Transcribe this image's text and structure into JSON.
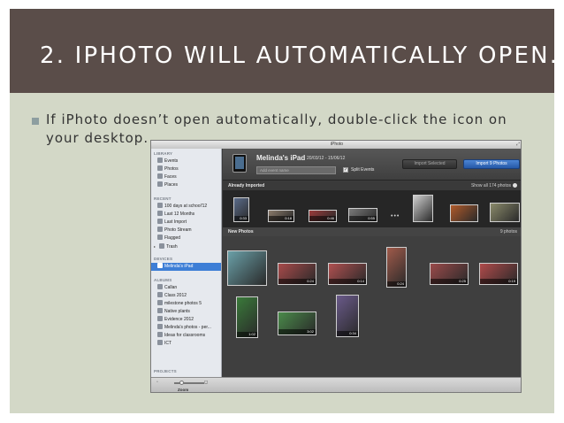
{
  "slide": {
    "title": "2.  IPHOTO WILL AUTOMATICALLY OPEN.",
    "bullet": "If iPhoto doesn’t open automatically, double-click the icon on your desktop."
  },
  "window": {
    "title": "iPhoto",
    "resize_glyph": "⤢"
  },
  "sidebar": {
    "library_heading": "LIBRARY",
    "library": [
      "Events",
      "Photos",
      "Faces",
      "Places"
    ],
    "recent_heading": "RECENT",
    "recent": [
      "100 days at school'12",
      "Last 12 Months",
      "Last Import",
      "Photo Stream",
      "Flagged",
      "Trash"
    ],
    "devices_heading": "DEVICES",
    "device": "Melinda's iPad",
    "albums_heading": "ALBUMS",
    "albums": [
      "Callan",
      "Class 2012",
      "milestone photos 5",
      "Native plants",
      "Evidence 2012",
      "Melinda's photos - per...",
      "Ideas for classrooms",
      "ICT"
    ],
    "projects_heading": "PROJECTS"
  },
  "device_header": {
    "name": "Melinda's iPad",
    "dates": "20/03/12 - 15/06/12",
    "event_placeholder": "Add event name",
    "split_events": "Split Events",
    "split_checked": "✓",
    "import_selected": "Import Selected",
    "import_photos": "Import 9 Photos"
  },
  "already_imported": {
    "heading": "Already Imported",
    "show_all": "Show all 174 photos",
    "more": "•••",
    "thumbs": [
      {
        "duration": "0:33",
        "color": "#5a6b8a"
      },
      {
        "duration": "0:18",
        "color": "#8a7a6a"
      },
      {
        "duration": "0:46",
        "color": "#9a3a3a"
      },
      {
        "duration": "0:55",
        "color": "#7a7a7a"
      },
      {
        "duration": "",
        "color": "#cfcfcf"
      },
      {
        "duration": "",
        "color": "#b05a2a"
      },
      {
        "duration": "",
        "color": "#8a8a6a"
      }
    ]
  },
  "new_photos": {
    "heading": "New Photos",
    "count": "9 photos",
    "thumbs": [
      {
        "duration": "",
        "color": "#6aa0a8"
      },
      {
        "duration": "0:24",
        "color": "#a84a4a"
      },
      {
        "duration": "0:14",
        "color": "#b05050"
      },
      {
        "duration": "0:24",
        "color": "#a05a4a"
      },
      {
        "duration": "0:25",
        "color": "#9a4a4a"
      },
      {
        "duration": "0:19",
        "color": "#b04a4a"
      },
      {
        "duration": "1:02",
        "color": "#3a7a3a"
      },
      {
        "duration": "3:02",
        "color": "#4a8a4a"
      },
      {
        "duration": "0:34",
        "color": "#6a5a8a"
      }
    ]
  },
  "bottom_bar": {
    "zoom_label": "Zoom",
    "zoom_small_icon": "▫",
    "zoom_big_icon": "◻"
  }
}
